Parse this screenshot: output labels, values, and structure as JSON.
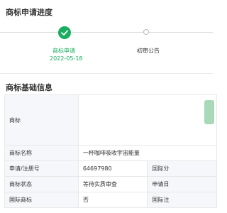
{
  "sections": {
    "progress_title": "商标申请进度",
    "basic_title": "商标基础信息"
  },
  "progress": {
    "steps": [
      {
        "label": "商标申请",
        "date": "2022-05-18",
        "status": "done",
        "icon": "check-circle-icon"
      },
      {
        "label": "初审公告",
        "status": "pending",
        "icon": "circle-dot-icon"
      }
    ],
    "colors": {
      "done": "#1aad5f",
      "pending": "#b8b8b8"
    }
  },
  "basic_info": {
    "logo_label": "商标",
    "rows": [
      {
        "label": "商标名称",
        "value": "一杯咖啡吸收宇宙能量"
      },
      {
        "label": "申请/注册号",
        "value": "64697980",
        "label2": "国际分"
      },
      {
        "label": "商标状态",
        "value": "等待实质审查",
        "label2": "申请日"
      },
      {
        "label": "国际商标",
        "value": "否",
        "label2": "国际注"
      }
    ]
  }
}
